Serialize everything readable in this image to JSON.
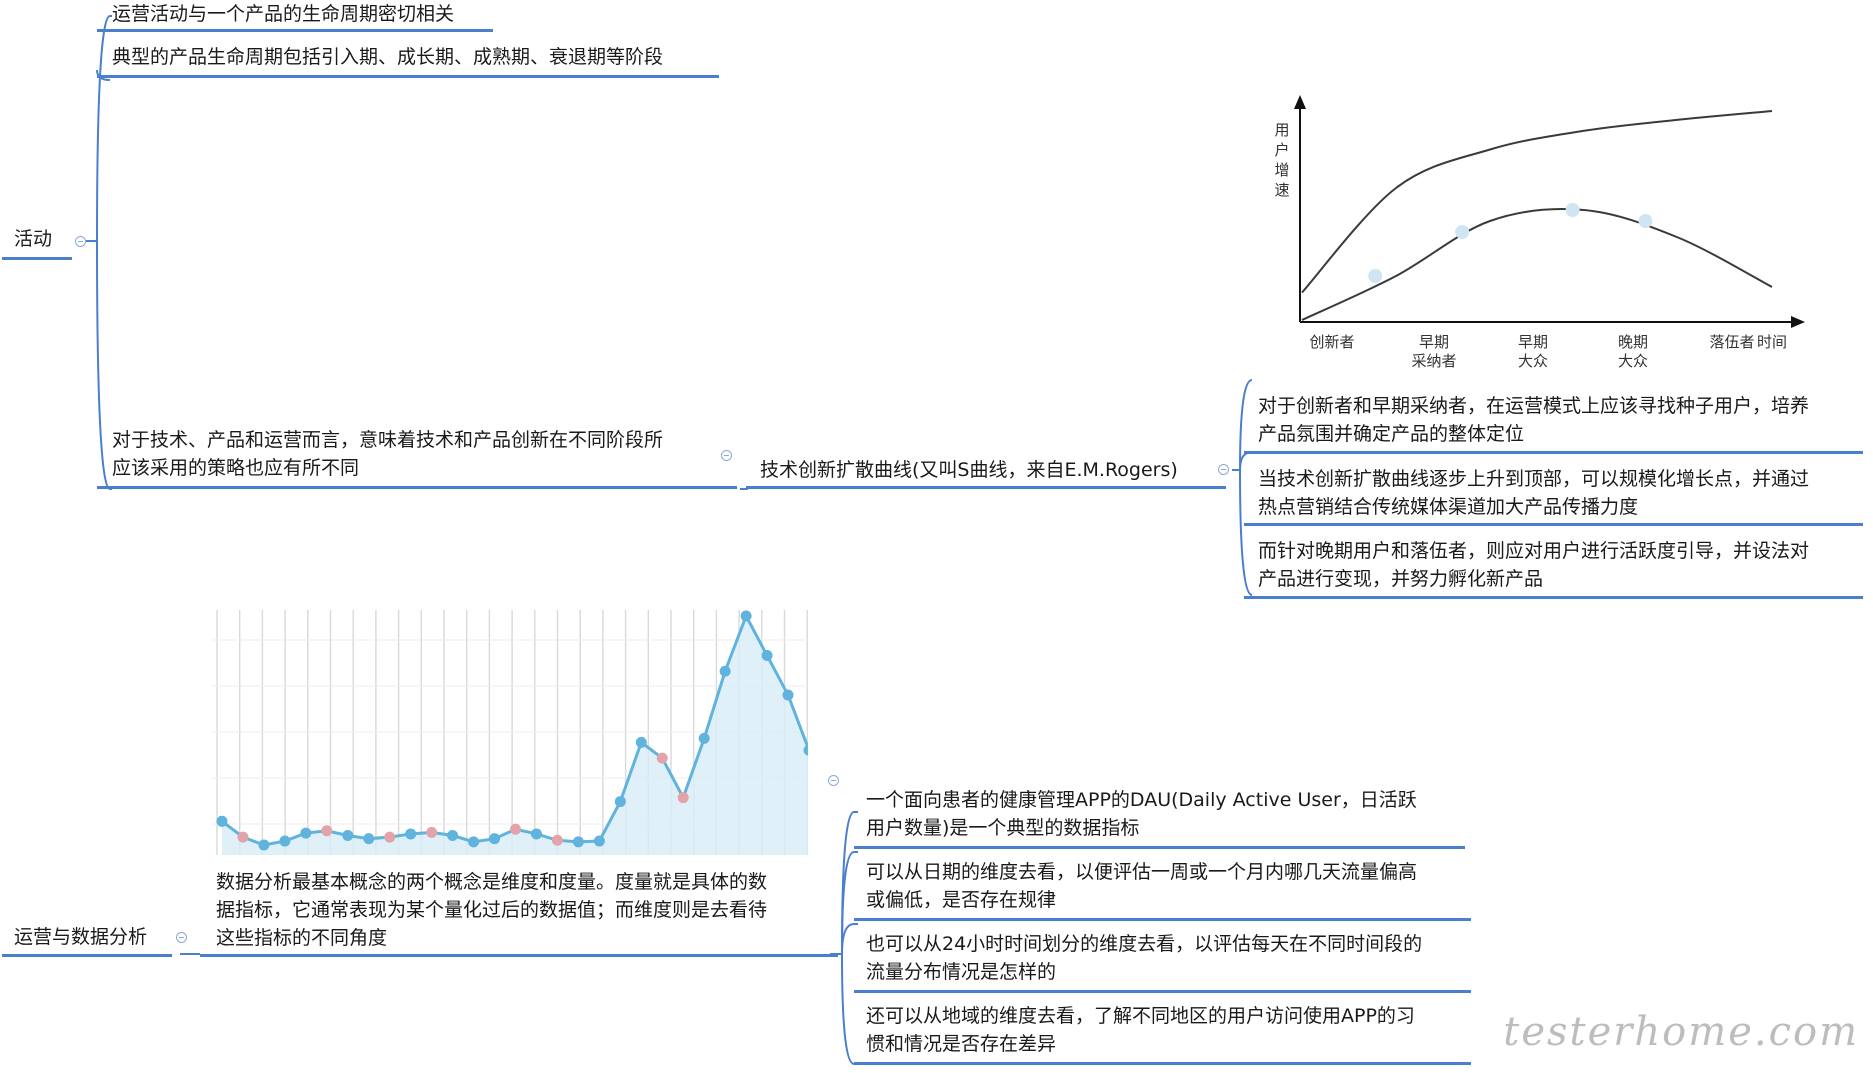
{
  "mindmap": {
    "activity": {
      "label": "活动",
      "children": {
        "lifecycle": "运营活动与一个产品的生命周期密切相关",
        "stages": "典型的产品生命周期包括引入期、成长期、成熟期、衰退期等阶段",
        "strategy": {
          "line1": "对于技术、产品和运营而言，意味着技术和产品创新在不同阶段所",
          "line2": "应该采用的策略也应有所不同"
        },
        "diffusion": {
          "label": "技术创新扩散曲线(又叫S曲线，来自E.M.Rogers)",
          "notes": [
            {
              "line1": "对于创新者和早期采纳者，在运营模式上应该寻找种子用户，培养",
              "line2": "产品氛围并确定产品的整体定位"
            },
            {
              "line1": "当技术创新扩散曲线逐步上升到顶部，可以规模化增长点，并通过",
              "line2": "热点营销结合传统媒体渠道加大产品传播力度"
            },
            {
              "line1": "而针对晚期用户和落伍者，则应对用户进行活跃度引导，并设法对",
              "line2": "产品进行变现，并努力孵化新产品"
            }
          ]
        }
      }
    },
    "data_analysis": {
      "label": "运营与数据分析",
      "concept": {
        "line1": "数据分析最基本概念的两个概念是维度和度量。度量就是具体的数",
        "line2": "据指标，它通常表现为某个量化过后的数据值；而维度则是去看待",
        "line3": "这些指标的不同角度"
      },
      "points": [
        {
          "line1": "一个面向患者的健康管理APP的DAU(Daily Active User，日活跃",
          "line2": "用户数量)是一个典型的数据指标"
        },
        {
          "line1": "可以从日期的维度去看，以便评估一周或一个月内哪几天流量偏高",
          "line2": "或偏低，是否存在规律"
        },
        {
          "line1": "也可以从24小时时间划分的维度去看，以评估每天在不同时间段的",
          "line2": "流量分布情况是怎样的"
        },
        {
          "line1": "还可以从地域的维度去看，了解不同地区的用户访问使用APP的习",
          "line2": "惯和情况是否存在差异"
        }
      ]
    }
  },
  "chart_data": [
    {
      "type": "line",
      "title": "",
      "ylabel": "用户增速",
      "xlabel": "时间",
      "categories": [
        "创新者",
        "早期采纳者",
        "早期大众",
        "晚期大众",
        "落伍者"
      ],
      "category_labels": [
        {
          "line1": "创新者",
          "line2": ""
        },
        {
          "line1": "早期",
          "line2": "采纳者"
        },
        {
          "line1": "早期",
          "line2": "大众"
        },
        {
          "line1": "晚期",
          "line2": "大众"
        },
        {
          "line1": "落伍者",
          "line2": ""
        }
      ],
      "xlabel_text": "时间",
      "ylabel_chars": [
        "用",
        "户",
        "增",
        "速"
      ],
      "series": [
        {
          "values": [
            0.0,
            0.4,
            0.9,
            1.0,
            0.75,
            0.3
          ]
        },
        {
          "values": [
            0.25,
            1.2,
            1.55,
            1.72,
            1.82,
            1.9
          ]
        }
      ],
      "markers_on_lower": [
        0.4,
        0.8,
        1.0,
        0.9
      ],
      "colors": {
        "line": "#3a3a3a",
        "marker": "#cfe6f2",
        "axis": "#111111"
      }
    },
    {
      "type": "area",
      "title": "",
      "values": [
        12,
        10,
        9,
        9.5,
        10.5,
        10.8,
        10.2,
        9.8,
        10,
        10.4,
        10.6,
        10.2,
        9.4,
        9.8,
        11,
        10.4,
        9.6,
        9.4,
        9.5,
        14.5,
        22,
        20,
        15,
        22.5,
        31,
        38,
        33,
        28,
        21
      ],
      "colors": {
        "line": "#5fb3dd",
        "fill": "#d7ecf8",
        "normal_marker": "#5fb3dd",
        "low_marker": "#e3a3aa",
        "grid": "#d9d9d9"
      }
    }
  ],
  "watermark": "testerhome.com",
  "colors": {
    "underline": "#4a7fd0",
    "connector": "#4a7fd0",
    "toggle": "#8ba9d8"
  }
}
